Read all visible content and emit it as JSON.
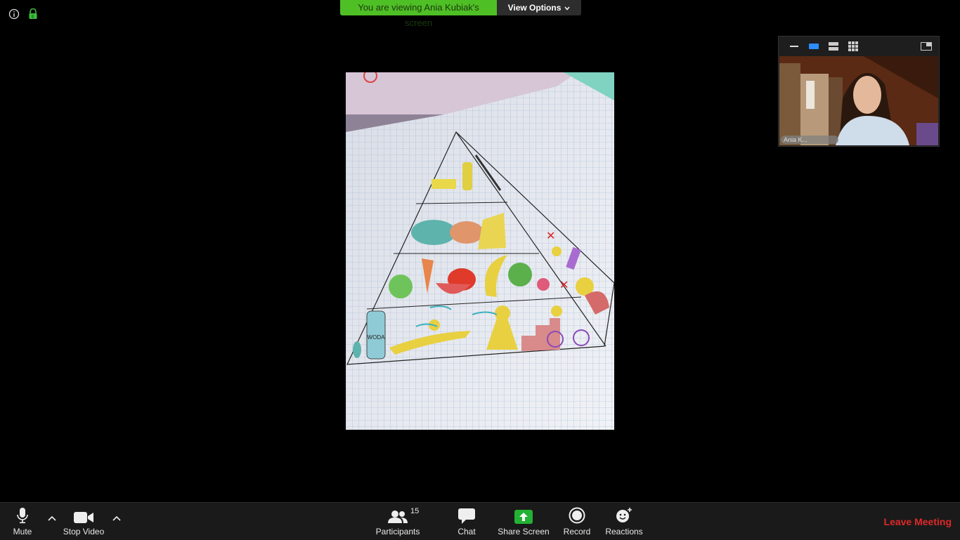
{
  "banner": {
    "viewing_text": "You are viewing Ania Kubiak's screen",
    "view_options_label": "View Options"
  },
  "shared_screen": {
    "label_on_bottle": "WODA"
  },
  "thumbnail": {
    "name_label": "Ania K..."
  },
  "toolbar": {
    "mute_label": "Mute",
    "stop_video_label": "Stop Video",
    "participants_label": "Participants",
    "participants_count": "15",
    "chat_label": "Chat",
    "share_screen_label": "Share Screen",
    "record_label": "Record",
    "reactions_label": "Reactions",
    "leave_label": "Leave Meeting"
  },
  "colors": {
    "banner_green": "#4fbf26",
    "share_green": "#23b234",
    "leave_red": "#e02828",
    "toolbar_bg": "#1a1a1a",
    "active_view_blue": "#2d8cff"
  },
  "icons": [
    "info-icon",
    "lock-shield-icon",
    "chevron-down-icon",
    "minimize-icon",
    "speaker-view-icon",
    "strip-view-icon",
    "gallery-view-icon",
    "exit-fullscreen-icon",
    "microphone-icon",
    "video-camera-icon",
    "participants-icon",
    "chat-bubble-icon",
    "share-screen-arrow-icon",
    "record-icon",
    "reaction-smile-icon"
  ]
}
